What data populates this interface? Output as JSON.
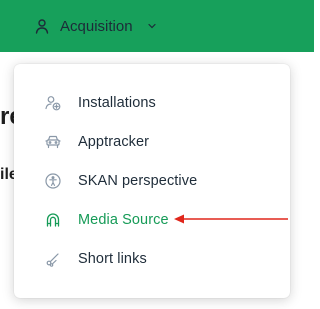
{
  "header": {
    "nav_label": "Acquisition",
    "nav_icon": "user-icon",
    "chevron_icon": "chevron-down-icon",
    "background_color": "#17a05b"
  },
  "background": {
    "heading_fragment": "re",
    "subtext_fragment": "ile"
  },
  "menu": {
    "items": [
      {
        "label": "Installations",
        "icon": "user-add-icon",
        "active": false
      },
      {
        "label": "Apptracker",
        "icon": "car-icon",
        "active": false
      },
      {
        "label": "SKAN perspective",
        "icon": "accessibility-icon",
        "active": false
      },
      {
        "label": "Media Source",
        "icon": "magnet-icon",
        "active": true
      },
      {
        "label": "Short links",
        "icon": "scissors-icon",
        "active": false
      }
    ],
    "active_color": "#169b57"
  },
  "annotation": {
    "arrow_color": "#e0261b"
  }
}
